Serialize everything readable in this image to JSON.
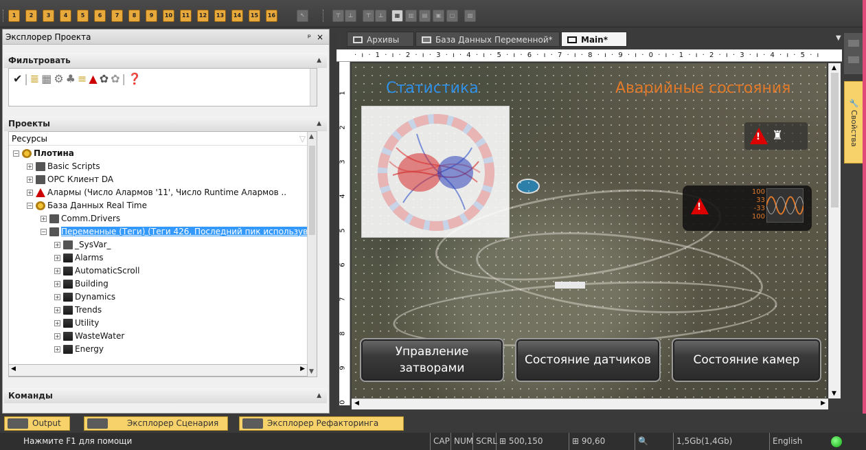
{
  "toolbar": {
    "numbered_buttons": [
      "1",
      "2",
      "3",
      "4",
      "5",
      "6",
      "7",
      "8",
      "9",
      "10",
      "11",
      "12",
      "13",
      "14",
      "15",
      "16"
    ]
  },
  "explorer": {
    "title": "Эксплорер Проекта",
    "pin": "ᵖ",
    "close": "×",
    "filter_header": "Фильтровать",
    "projects_header": "Проекты",
    "resources_label": "Ресурсы",
    "commands_header": "Команды",
    "tree": [
      {
        "label": "Плотина",
        "level": 0,
        "icon": "gear-icon",
        "expander": "⊟",
        "bold": true
      },
      {
        "label": "Basic Scripts",
        "level": 1,
        "icon": "script-icon",
        "expander": "⊞"
      },
      {
        "label": "OPC Клиент DA",
        "level": 1,
        "icon": "plug-icon",
        "expander": "⊞"
      },
      {
        "label": "Алармы (Число Алармов '11', Число Runtime Алармов ..",
        "level": 1,
        "icon": "bell-icon",
        "expander": "⊞"
      },
      {
        "label": "База Данных Real Time",
        "level": 1,
        "icon": "gear-icon",
        "expander": "⊟"
      },
      {
        "label": "Comm.Drivers",
        "level": 2,
        "icon": "plug-icon",
        "expander": "⊞"
      },
      {
        "label": "Переменные (Теги) (Теги 426, Последний пик использув..",
        "level": 2,
        "icon": "tags-icon",
        "expander": "⊟",
        "selected": true
      },
      {
        "label": "_SysVar_",
        "level": 3,
        "icon": "sysvar-icon",
        "expander": "⊞"
      },
      {
        "label": "Alarms",
        "level": 3,
        "icon": "folder-icon",
        "expander": "⊞"
      },
      {
        "label": "AutomaticScroll",
        "level": 3,
        "icon": "folder-icon",
        "expander": "⊞"
      },
      {
        "label": "Building",
        "level": 3,
        "icon": "folder-icon",
        "expander": "⊞"
      },
      {
        "label": "Dynamics",
        "level": 3,
        "icon": "folder-icon",
        "expander": "⊞"
      },
      {
        "label": "Trends",
        "level": 3,
        "icon": "folder-icon",
        "expander": "⊞"
      },
      {
        "label": "Utility",
        "level": 3,
        "icon": "folder-icon",
        "expander": "⊞"
      },
      {
        "label": "WasteWater",
        "level": 3,
        "icon": "folder-icon",
        "expander": "⊞"
      },
      {
        "label": "Energy",
        "level": 3,
        "icon": "folder-icon",
        "expander": "⊞"
      }
    ]
  },
  "tabs": [
    {
      "label": "Архивы",
      "active": false
    },
    {
      "label": "База Данных Переменной*",
      "active": false
    },
    {
      "label": "Main*",
      "active": true,
      "close": "×"
    }
  ],
  "ruler": {
    "top": "· ı · 1 · ı · 2 · ı · 3 · ı · 4 · ı · 5 · ı · 6 · ı · 7 · ı · 8 · ı · 9 · ı · 0 · ı · 1 · ı · 2 · ı · 3 · ı · 4 · ı · 5 · ı",
    "left": [
      "1",
      "2",
      "3",
      "4",
      "5",
      "6",
      "7",
      "8",
      "9",
      "0"
    ]
  },
  "screen": {
    "stat_title": "Статистика",
    "alarm_title": "Аварийные состояния",
    "alarm_values": [
      "100",
      "33",
      "-33",
      "100"
    ],
    "buttons": [
      "Управление затворами",
      "Состояние датчиков",
      "Состояние камер"
    ]
  },
  "props_tab": "Свойства",
  "bottom_tabs": [
    {
      "label": "Output"
    },
    {
      "label": "Эксплорер Сценария"
    },
    {
      "label": "Эксплорер Рефакторинга"
    }
  ],
  "status": {
    "help": "Нажмите F1 для помощи",
    "cap": "CAP",
    "num": "NUM",
    "scrl": "SCRL",
    "pos": "500,150",
    "size": "90,60",
    "memory": "1,5Gb(1,4Gb)",
    "language": "English"
  },
  "colors": {
    "accent": "#f7d26a",
    "stat_title": "#2e8fe6",
    "alarm_title": "#e07a2a"
  }
}
